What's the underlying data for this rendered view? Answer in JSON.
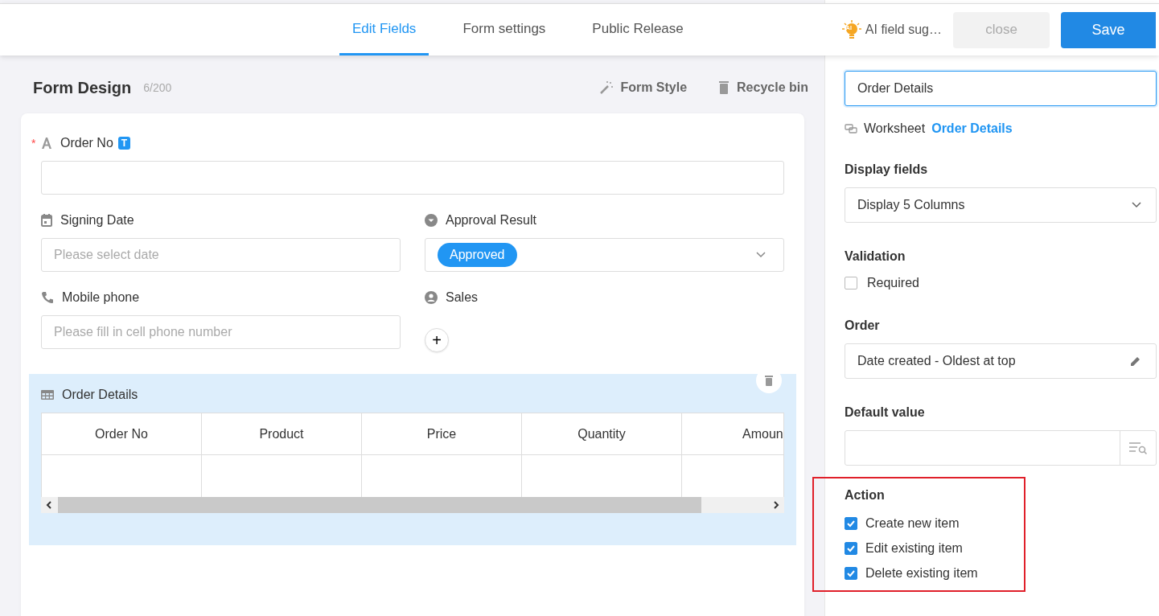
{
  "header": {
    "tabs": [
      {
        "label": "Edit Fields",
        "selected": true
      },
      {
        "label": "Form settings",
        "selected": false
      },
      {
        "label": "Public Release",
        "selected": false
      }
    ],
    "ai_suggest": "AI field sug…",
    "ai_badge": "AI",
    "close": "close",
    "save": "Save"
  },
  "form": {
    "title": "Form Design",
    "count": "6/200",
    "form_style": "Form Style",
    "recycle_bin": "Recycle bin",
    "fields": [
      {
        "kind": "text",
        "label": "Order No",
        "required_mark": "*",
        "type_badge": "T"
      },
      {
        "kind": "date",
        "label": "Signing Date",
        "placeholder": "Please select date"
      },
      {
        "kind": "select",
        "label": "Approval Result",
        "value": "Approved"
      },
      {
        "kind": "phone",
        "label": "Mobile phone",
        "placeholder": "Please fill in cell phone number"
      },
      {
        "kind": "user",
        "label": "Sales",
        "add": "+"
      }
    ],
    "subtable": {
      "label": "Order Details",
      "selected": true,
      "columns": [
        "Order No",
        "Product",
        "Price",
        "Quantity",
        "Amoun"
      ]
    }
  },
  "panel": {
    "field_name": "Order Details",
    "worksheet_label": "Worksheet",
    "worksheet_link": "Order Details",
    "display_label": "Display fields",
    "display_value": "Display 5 Columns",
    "validation_label": "Validation",
    "required": {
      "label": "Required",
      "checked": false
    },
    "order_label": "Order",
    "order_value": "Date created - Oldest at top",
    "default_label": "Default value",
    "action_label": "Action",
    "actions": [
      {
        "label": "Create new item",
        "checked": true
      },
      {
        "label": "Edit existing item",
        "checked": true
      },
      {
        "label": "Delete existing item",
        "checked": true
      }
    ]
  }
}
